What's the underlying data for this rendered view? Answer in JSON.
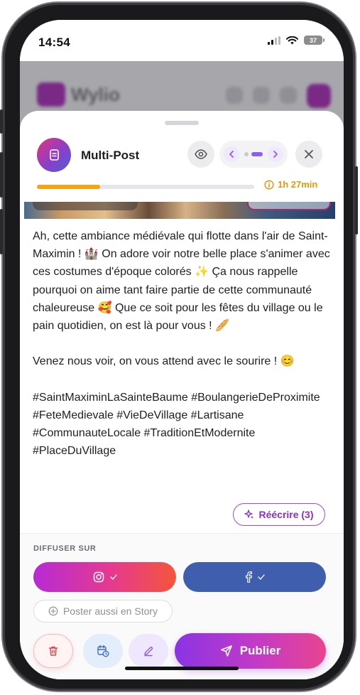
{
  "status_bar": {
    "time": "14:54",
    "battery": "37"
  },
  "background_app": {
    "logo_text": "Wylio"
  },
  "header": {
    "title": "Multi-Post",
    "timer": "1h 27min"
  },
  "progress": {
    "fraction": 0.29
  },
  "post": {
    "text": "Ah, cette ambiance médiévale qui flotte dans l'air de Saint-Maximin ! 🏰 On adore voir notre belle place s'animer avec ces costumes d'époque colorés ✨ Ça nous rappelle pourquoi on aime tant faire partie de cette communauté chaleureuse 🥰 Que ce soit pour les fêtes du village ou le pain quotidien, on est là pour vous ! 🥖\n\nVenez nous voir, on vous attend avec le sourire ! 😊\n\n#SaintMaximinLaSainteBaume #BoulangerieDeProximite #FeteMedievale #VieDeVillage #Lartisane #CommunauteLocale #TraditionEtModernite #PlaceDuVillage"
  },
  "rewrite": {
    "label": "Réécrire (3)"
  },
  "diffuser": {
    "label": "DIFFUSER SUR",
    "story_label": "Poster aussi en Story"
  },
  "actions": {
    "publish_label": "Publier"
  },
  "colors": {
    "accent": "#8b5cf6",
    "progress": "#f5a416",
    "facebook": "#3f5fae",
    "delete": "#e0474c"
  },
  "icons": {
    "app": "stack-icon",
    "preview": "eye-icon",
    "close": "close-icon",
    "instagram": "instagram-icon",
    "facebook": "facebook-icon",
    "story": "plus-circle-icon",
    "delete": "trash-icon",
    "schedule": "calendar-clock-icon",
    "edit": "pencil-icon",
    "publish": "send-icon",
    "timer": "info-circle-icon",
    "rewrite": "sparkle-icon"
  }
}
